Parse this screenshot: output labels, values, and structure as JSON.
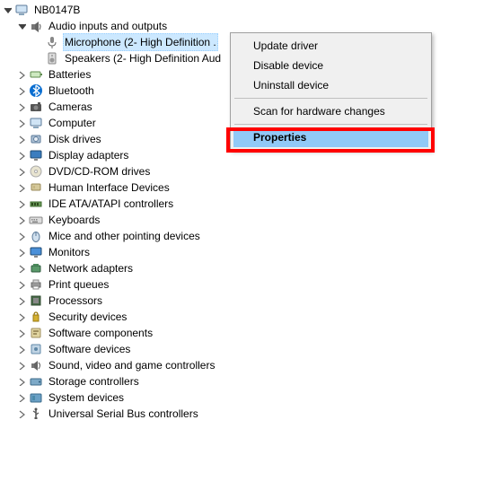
{
  "tree": {
    "root": {
      "label": "NB0147B"
    },
    "audio": {
      "label": "Audio inputs and outputs"
    },
    "microphone": {
      "label": "Microphone (2- High Definition ."
    },
    "speakers": {
      "label": "Speakers (2- High Definition Aud"
    },
    "batteries": {
      "label": "Batteries"
    },
    "bluetooth": {
      "label": "Bluetooth"
    },
    "cameras": {
      "label": "Cameras"
    },
    "computer": {
      "label": "Computer"
    },
    "diskdrives": {
      "label": "Disk drives"
    },
    "display": {
      "label": "Display adapters"
    },
    "dvd": {
      "label": "DVD/CD-ROM drives"
    },
    "hid": {
      "label": "Human Interface Devices"
    },
    "ide": {
      "label": "IDE ATA/ATAPI controllers"
    },
    "keyboards": {
      "label": "Keyboards"
    },
    "mice": {
      "label": "Mice and other pointing devices"
    },
    "monitors": {
      "label": "Monitors"
    },
    "network": {
      "label": "Network adapters"
    },
    "printq": {
      "label": "Print queues"
    },
    "processors": {
      "label": "Processors"
    },
    "security": {
      "label": "Security devices"
    },
    "swcomp": {
      "label": "Software components"
    },
    "swdev": {
      "label": "Software devices"
    },
    "sound": {
      "label": "Sound, video and game controllers"
    },
    "storage": {
      "label": "Storage controllers"
    },
    "system": {
      "label": "System devices"
    },
    "usb": {
      "label": "Universal Serial Bus controllers"
    }
  },
  "menu": {
    "update": "Update driver",
    "disable": "Disable device",
    "uninstall": "Uninstall device",
    "scan": "Scan for hardware changes",
    "properties": "Properties"
  }
}
